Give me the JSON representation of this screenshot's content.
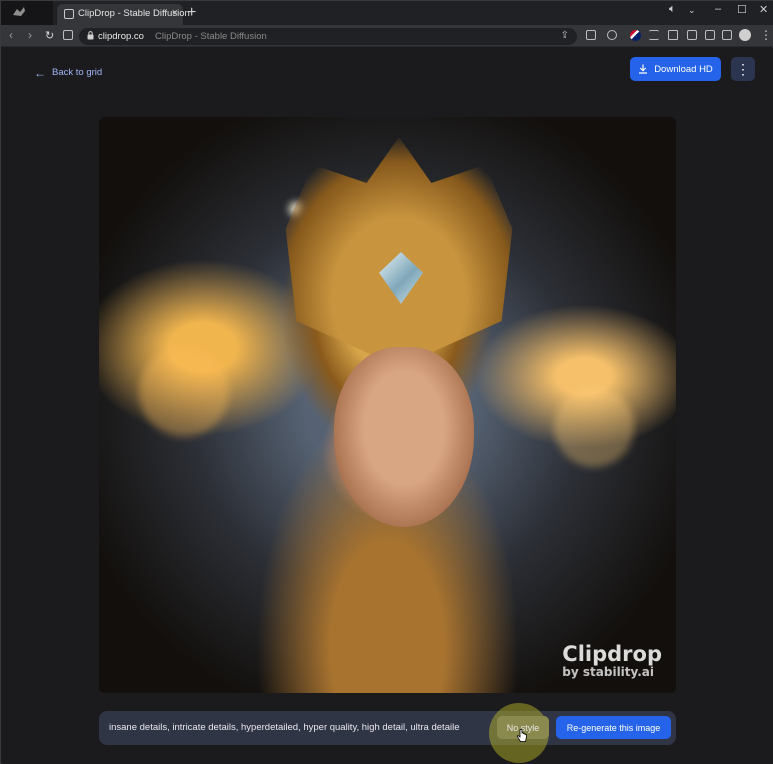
{
  "browser": {
    "tab_title": "ClipDrop - Stable Diffusion",
    "tab_close": "×",
    "new_tab": "+",
    "domain": "clipdrop.co",
    "page_title": "ClipDrop - Stable Diffusion",
    "window_controls": {
      "minimize": "–",
      "maximize": "☐",
      "close": "✕"
    }
  },
  "header": {
    "back_label": "Back to grid",
    "download_label": "Download HD",
    "more_label": "⋮"
  },
  "image": {
    "watermark_main": "Clipdrop",
    "watermark_sub": "by stability.ai"
  },
  "prompt_bar": {
    "prompt_text": "insane details, intricate details, hyperdetailed, hyper quality, high detail, ultra detaile",
    "style_label": "No style",
    "regenerate_label": "Re-generate this image"
  },
  "colors": {
    "accent": "#2563eb",
    "background": "#1b1b1d",
    "prompt_bg": "#303546"
  }
}
